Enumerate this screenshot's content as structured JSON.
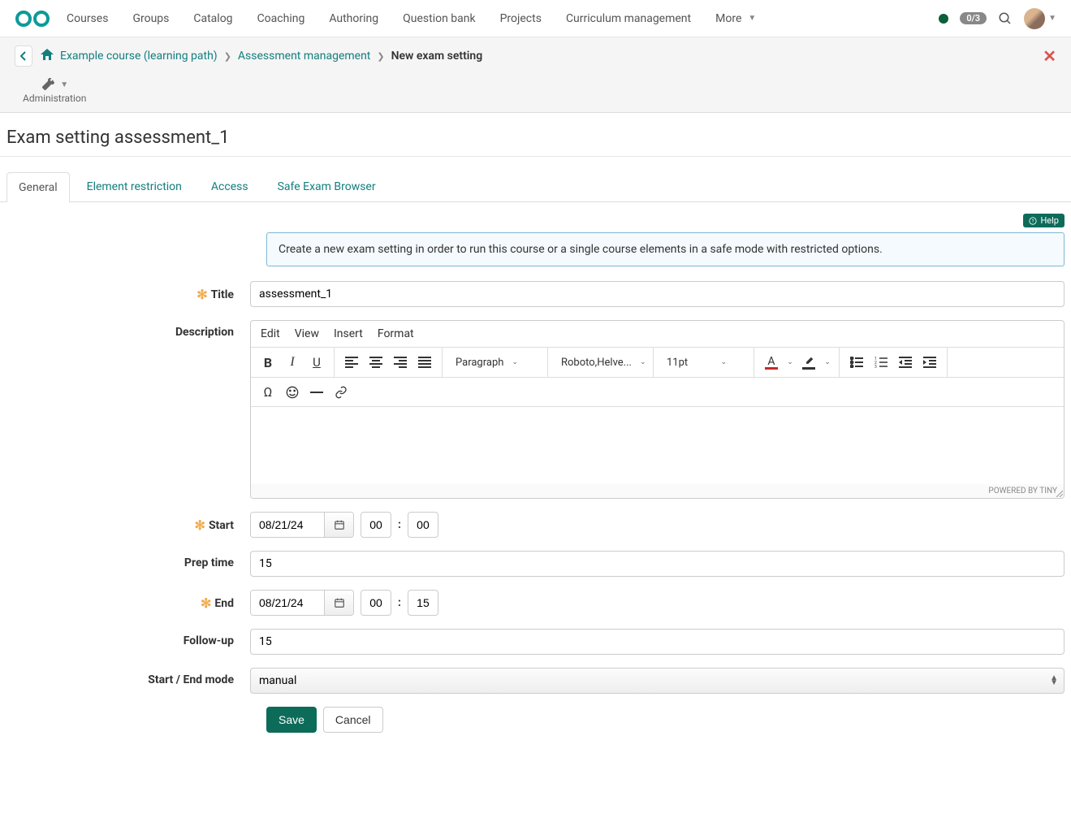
{
  "nav": {
    "items": [
      "Courses",
      "Groups",
      "Catalog",
      "Coaching",
      "Authoring",
      "Question bank",
      "Projects",
      "Curriculum management"
    ],
    "more": "More",
    "badge": "0/3"
  },
  "breadcrumb": {
    "course": "Example course (learning path)",
    "section": "Assessment management",
    "current": "New exam setting",
    "admin": "Administration"
  },
  "page": {
    "title": "Exam setting assessment_1"
  },
  "tabs": [
    "General",
    "Element restriction",
    "Access",
    "Safe Exam Browser"
  ],
  "help": "Help",
  "form": {
    "info": "Create a new exam setting in order to run this course or a single course elements in a safe mode with restricted options.",
    "labels": {
      "title": "Title",
      "description": "Description",
      "start": "Start",
      "prep": "Prep time",
      "end": "End",
      "followup": "Follow-up",
      "mode": "Start / End mode"
    },
    "title_value": "assessment_1",
    "editor": {
      "menu": [
        "Edit",
        "View",
        "Insert",
        "Format"
      ],
      "block": "Paragraph",
      "font": "Roboto,Helve...",
      "size": "11pt",
      "footer": "POWERED BY TINY"
    },
    "start": {
      "date": "08/21/24",
      "hh": "00",
      "mm": "00"
    },
    "prep_value": "15",
    "end": {
      "date": "08/21/24",
      "hh": "00",
      "mm": "15"
    },
    "followup_value": "15",
    "mode_value": "manual",
    "buttons": {
      "save": "Save",
      "cancel": "Cancel"
    }
  }
}
